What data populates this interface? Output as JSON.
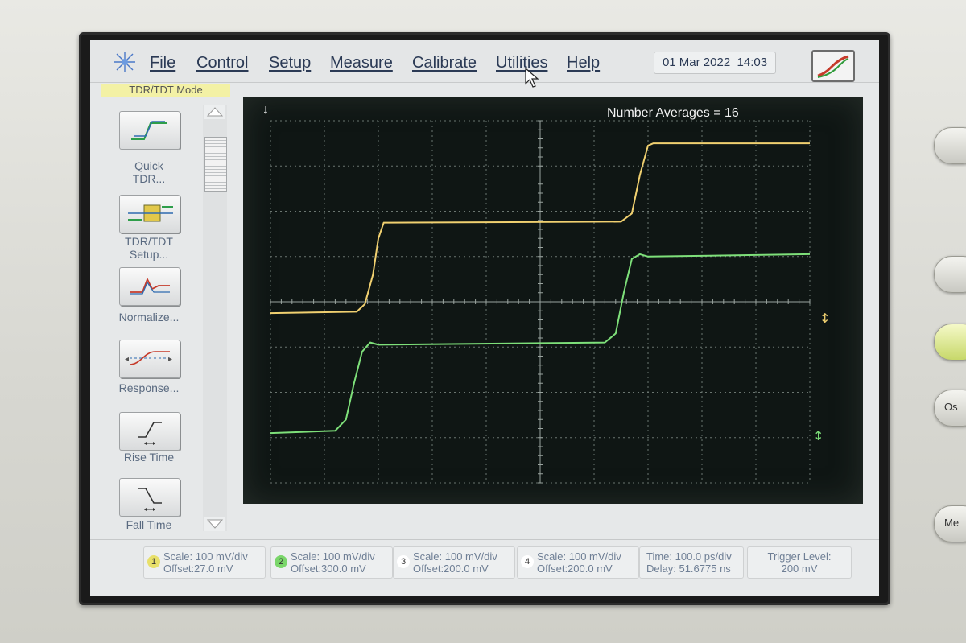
{
  "menu": {
    "items": [
      "File",
      "Control",
      "Setup",
      "Measure",
      "Calibrate",
      "Utilities",
      "Help"
    ],
    "date": "01 Mar 2022",
    "time": "14:03"
  },
  "panel": {
    "mode_label": "TDR/TDT Mode",
    "buttons": [
      {
        "label_line1": "Quick",
        "label_line2": "TDR...",
        "icon": "quick-tdr-icon"
      },
      {
        "label_line1": "TDR/TDT",
        "label_line2": "Setup...",
        "icon": "tdr-setup-icon"
      },
      {
        "label_line1": "Normalize...",
        "label_line2": "",
        "icon": "normalize-icon"
      },
      {
        "label_line1": "Response...",
        "label_line2": "",
        "icon": "response-icon"
      },
      {
        "label_line1": "Rise Time",
        "label_line2": "",
        "icon": "rise-time-icon"
      },
      {
        "label_line1": "Fall Time",
        "label_line2": "",
        "icon": "fall-time-icon"
      }
    ]
  },
  "scope": {
    "number_averages": "Number Averages = 16",
    "colors": {
      "trace_yellow": "#f0d070",
      "trace_green": "#7ee07a",
      "grid": "#6a7570"
    }
  },
  "chart_data": {
    "type": "line",
    "xlabel": "",
    "ylabel": "",
    "x_divisions": 10,
    "y_divisions": 8,
    "series": [
      {
        "x": [
          0,
          1.6,
          1.75,
          1.9,
          2.0,
          2.1,
          2.2,
          6.5,
          6.7,
          6.85,
          7.0,
          7.1,
          7.2,
          10
        ],
        "y": [
          -0.25,
          -0.22,
          -0.05,
          0.6,
          1.4,
          1.75,
          1.75,
          1.77,
          1.95,
          2.8,
          3.45,
          3.5,
          3.5,
          3.5
        ]
      },
      {
        "x": [
          0,
          1.2,
          1.4,
          1.55,
          1.7,
          1.85,
          2.0,
          6.2,
          6.4,
          6.55,
          6.7,
          6.85,
          7.0,
          10
        ],
        "y": [
          -2.9,
          -2.85,
          -2.6,
          -1.8,
          -1.1,
          -0.9,
          -0.95,
          -0.9,
          -0.7,
          0.2,
          0.95,
          1.05,
          1.0,
          1.05
        ]
      }
    ]
  },
  "status": {
    "channels": [
      {
        "num": "1",
        "scale": "Scale: 100 mV/div",
        "offset": "Offset:27.0 mV",
        "color": "#e8e06a"
      },
      {
        "num": "2",
        "scale": "Scale: 100 mV/div",
        "offset": "Offset:300.0 mV",
        "color": "#7ad66a"
      },
      {
        "num": "3",
        "scale": "Scale: 100 mV/div",
        "offset": "Offset:200.0 mV",
        "color": "#ffffff"
      },
      {
        "num": "4",
        "scale": "Scale: 100 mV/div",
        "offset": "Offset:200.0 mV",
        "color": "#ffffff"
      }
    ],
    "time_scale": "Time:  100.0 ps/div",
    "delay": "Delay: 51.6775 ns",
    "trigger_title": "Trigger Level:",
    "trigger_value": "200 mV"
  },
  "hardware": {
    "button_o": "Os",
    "button_m": "Me"
  }
}
